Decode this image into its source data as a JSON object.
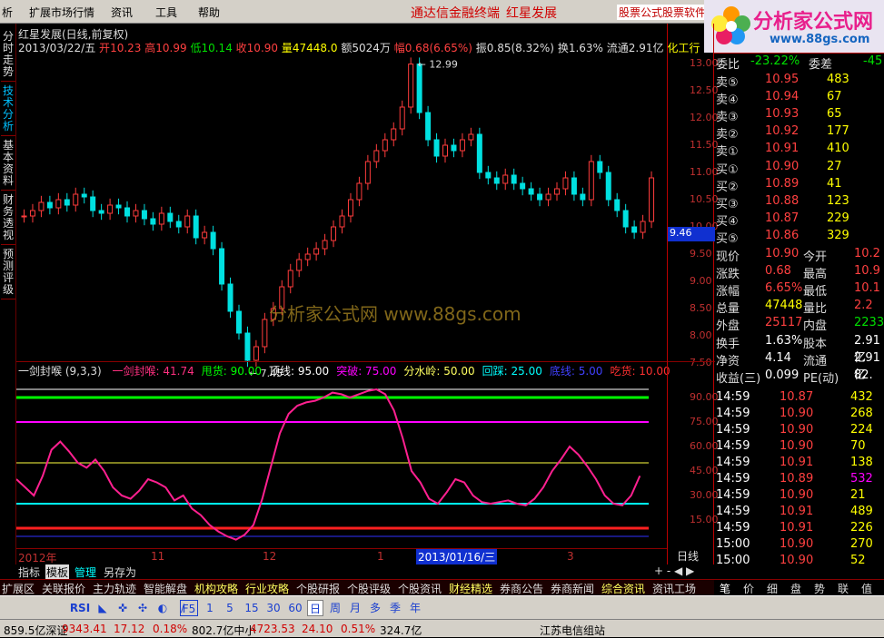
{
  "menu": {
    "items": [
      "析",
      "扩展市场行情",
      "资讯",
      "工具",
      "帮助"
    ],
    "center_title": "通达信金融终端",
    "stock_title": "红星发展",
    "promo": "股票公式股票软件",
    "logo_text": "分析家公式网",
    "logo_url": "www.88gs.com"
  },
  "left_tabs": [
    "分时走势",
    "技术分析",
    "基本资料",
    "财务透视",
    "预测评级"
  ],
  "chart": {
    "title": "红星发展(日线,前复权)",
    "info_date": "2013/03/22/五",
    "open_label": "开",
    "open": "10.23",
    "high_label": "高",
    "high": "10.99",
    "low_label": "低",
    "low": "10.14",
    "close_label": "收",
    "close": "10.90",
    "vol_label": "量",
    "vol": "47448.0",
    "amt_label": "额",
    "amt": "5024万",
    "chg_label": "幅",
    "chg": "0.68(6.65%)",
    "amp_label": "振",
    "amp": "0.85(8.32%)",
    "turn_label": "换",
    "turn": "1.63%",
    "float_label": "流通",
    "float": "2.91亿",
    "industry": "化工行",
    "max_label": "12.99",
    "min_label": "7.45",
    "price_marker": "9.46",
    "watermark": "分析家公式网 www.88gs.com",
    "ticks": [
      "13.00",
      "12.50",
      "12.00",
      "11.50",
      "11.00",
      "10.50",
      "10.00",
      "9.50",
      "9.00",
      "8.50",
      "8.00",
      "7.50"
    ],
    "ind_ticks": [
      "90.00",
      "75.00",
      "60.00",
      "45.00",
      "30.00",
      "15.00"
    ]
  },
  "indicator": {
    "name": "一剑封喉 (9,3,3)",
    "labels": [
      {
        "t": "一剑封喉: 41.74",
        "c": "#ff3080"
      },
      {
        "t": "甩货: 90.00",
        "c": "#00ff00"
      },
      {
        "t": "顶线: 95.00",
        "c": "#ffffff"
      },
      {
        "t": "突破: 75.00",
        "c": "#ff00ff"
      },
      {
        "t": "分水岭: 50.00",
        "c": "#ffff60"
      },
      {
        "t": "回踩: 25.00",
        "c": "#00ffff"
      },
      {
        "t": "底线: 5.00",
        "c": "#4040ff"
      },
      {
        "t": "吃货: 10.00",
        "c": "#ff3030"
      }
    ]
  },
  "timeaxis": {
    "labels": [
      "2012年",
      "11",
      "12",
      "1",
      "3"
    ],
    "cursor": "2013/01/16/三",
    "period": "日线"
  },
  "tabstrip": [
    "指标",
    "模板",
    "管理",
    "另存为"
  ],
  "bottomnav": [
    "扩展区",
    "关联报价",
    "主力轨迹",
    "智能解盘",
    "机构攻略",
    "行业攻略",
    "个股研报",
    "个股评级",
    "个股资讯",
    "财经精选",
    "券商公告",
    "券商新闻",
    "综合资讯",
    "资讯工场"
  ],
  "rtabs": [
    "笔",
    "价",
    "细",
    "盘",
    "势",
    "联",
    "值"
  ],
  "toolbar": {
    "periods": [
      "1",
      "5",
      "15",
      "30",
      "60",
      "日",
      "周",
      "月",
      "多",
      "季",
      "年"
    ],
    "f5": "F5",
    "rsi": "RSI"
  },
  "status": {
    "items": [
      "859.5亿深证",
      "9343.41",
      "17.12",
      "0.18%",
      "802.7亿中小",
      "4723.53",
      "24.10",
      "0.51%",
      "324.7亿",
      "江苏电信组站"
    ]
  },
  "quote": {
    "weibi_label": "委比",
    "weibi": "-23.22%",
    "weicha_label": "委差",
    "weicha": "-45",
    "sells": [
      {
        "l": "卖⑤",
        "p": "10.95",
        "v": "483"
      },
      {
        "l": "卖④",
        "p": "10.94",
        "v": "67"
      },
      {
        "l": "卖③",
        "p": "10.93",
        "v": "65"
      },
      {
        "l": "卖②",
        "p": "10.92",
        "v": "177"
      },
      {
        "l": "卖①",
        "p": "10.91",
        "v": "410"
      }
    ],
    "buys": [
      {
        "l": "买①",
        "p": "10.90",
        "v": "27"
      },
      {
        "l": "买②",
        "p": "10.89",
        "v": "41"
      },
      {
        "l": "买③",
        "p": "10.88",
        "v": "123"
      },
      {
        "l": "买④",
        "p": "10.87",
        "v": "229"
      },
      {
        "l": "买⑤",
        "p": "10.86",
        "v": "329"
      }
    ],
    "stats": [
      {
        "l1": "现价",
        "v1": "10.90",
        "l2": "今开",
        "v2": "10.2"
      },
      {
        "l1": "涨跌",
        "v1": "0.68",
        "l2": "最高",
        "v2": "10.9"
      },
      {
        "l1": "涨幅",
        "v1": "6.65%",
        "l2": "最低",
        "v2": "10.1"
      },
      {
        "l1": "总量",
        "v1": "47448",
        "l2": "量比",
        "v2": "2.2"
      },
      {
        "l1": "外盘",
        "v1": "25117",
        "l2": "内盘",
        "v2": "2233"
      }
    ],
    "stats2": [
      {
        "l1": "换手",
        "v1": "1.63%",
        "l2": "股本",
        "v2": "2.91亿"
      },
      {
        "l1": "净资",
        "v1": "4.14",
        "l2": "流通",
        "v2": "2.91亿"
      },
      {
        "l1": "收益(三)",
        "v1": "0.099",
        "l2": "PE(动)",
        "v2": "82."
      }
    ],
    "ticks": [
      {
        "t": "14:59",
        "p": "10.87",
        "v": "432"
      },
      {
        "t": "14:59",
        "p": "10.90",
        "v": "268"
      },
      {
        "t": "14:59",
        "p": "10.90",
        "v": "224"
      },
      {
        "t": "14:59",
        "p": "10.90",
        "v": "70"
      },
      {
        "t": "14:59",
        "p": "10.91",
        "v": "138"
      },
      {
        "t": "14:59",
        "p": "10.89",
        "v": "532"
      },
      {
        "t": "14:59",
        "p": "10.90",
        "v": "21"
      },
      {
        "t": "14:59",
        "p": "10.91",
        "v": "489"
      },
      {
        "t": "14:59",
        "p": "10.91",
        "v": "226"
      },
      {
        "t": "15:00",
        "p": "10.90",
        "v": "270"
      },
      {
        "t": "15:00",
        "p": "10.90",
        "v": "52"
      }
    ]
  },
  "chart_data": {
    "type": "line",
    "ohlc_close": [
      10.2,
      10.3,
      10.45,
      10.35,
      10.5,
      10.4,
      10.6,
      10.55,
      10.3,
      10.25,
      10.4,
      10.35,
      10.2,
      10.3,
      10.15,
      10.05,
      10.25,
      10.1,
      10.0,
      10.2,
      9.8,
      9.9,
      9.6,
      8.95,
      8.45,
      8.05,
      7.55,
      7.8,
      8.3,
      8.5,
      8.9,
      9.2,
      9.4,
      9.5,
      9.6,
      9.75,
      10.0,
      10.2,
      10.5,
      10.8,
      11.2,
      11.4,
      11.6,
      11.8,
      12.2,
      12.99,
      12.1,
      11.6,
      11.3,
      11.5,
      11.4,
      11.6,
      11.7,
      11.0,
      10.9,
      10.8,
      10.95,
      10.8,
      10.7,
      10.6,
      10.5,
      10.6,
      10.7,
      10.9,
      10.6,
      10.5,
      11.2,
      11.0,
      10.5,
      10.3,
      10.0,
      9.9,
      10.1,
      10.9
    ],
    "indicator": [
      40,
      35,
      30,
      42,
      58,
      63,
      57,
      50,
      47,
      52,
      45,
      35,
      30,
      28,
      33,
      40,
      38,
      35,
      27,
      30,
      22,
      18,
      12,
      8,
      5,
      3,
      6,
      12,
      28,
      48,
      68,
      80,
      85,
      87,
      88,
      90,
      93,
      92,
      90,
      92,
      94,
      95,
      92,
      82,
      65,
      45,
      38,
      28,
      25,
      32,
      40,
      38,
      30,
      26,
      25,
      26,
      27,
      25,
      24,
      28,
      35,
      45,
      52,
      60,
      55,
      48,
      40,
      30,
      25,
      24,
      30,
      42
    ],
    "indicator_levels": {
      "shuaihuo": 90,
      "dingxian": 95,
      "tupo": 75,
      "fenshuiling": 50,
      "huicai": 25,
      "dixian": 5,
      "chihuo": 10
    },
    "price_ylim": [
      7.45,
      12.99
    ]
  }
}
